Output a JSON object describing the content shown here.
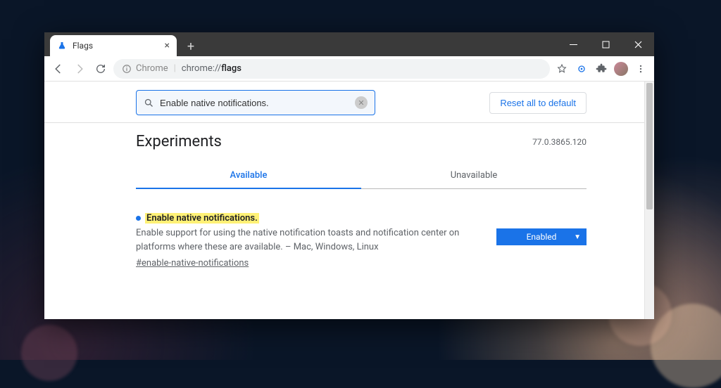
{
  "tab": {
    "title": "Flags"
  },
  "omnibox": {
    "prefix": "Chrome",
    "path_prefix": "chrome://",
    "path_bold": "flags"
  },
  "search": {
    "value": "Enable native notifications."
  },
  "buttons": {
    "reset": "Reset all to default"
  },
  "page": {
    "title": "Experiments",
    "version": "77.0.3865.120"
  },
  "tabs": {
    "available": "Available",
    "unavailable": "Unavailable"
  },
  "flag": {
    "title": "Enable native notifications.",
    "desc": "Enable support for using the native notification toasts and notification center on platforms where these are available. – Mac, Windows, Linux",
    "anchor": "#enable-native-notifications",
    "state": "Enabled"
  }
}
